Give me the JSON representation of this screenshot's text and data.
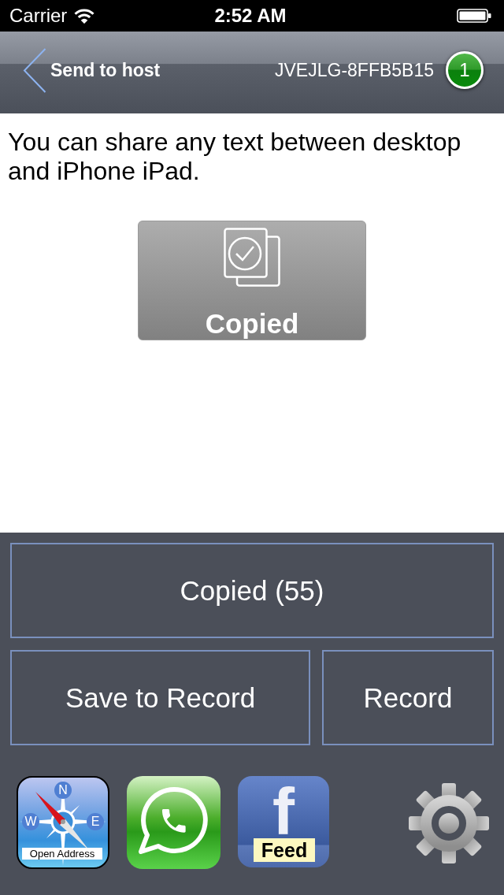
{
  "status_bar": {
    "carrier": "Carrier",
    "time": "2:52 AM"
  },
  "nav_bar": {
    "back_label": "Send to host",
    "device_id": "JVEJLG-8FFB5B15",
    "badge": "1"
  },
  "message": "You can share any text between desktop and iPhone iPad.",
  "status_button": {
    "label": "Copied"
  },
  "actions": [
    {
      "label": "Copied (55)"
    },
    {
      "label": "Save to Record"
    },
    {
      "label": "Record"
    }
  ],
  "app_shortcuts": [
    {
      "kind": "compass",
      "letters": [
        "N",
        "W",
        "E"
      ],
      "caption": "Open Address"
    },
    {
      "kind": "chat"
    },
    {
      "kind": "feed",
      "letter": "f",
      "caption": "Feed"
    }
  ]
}
